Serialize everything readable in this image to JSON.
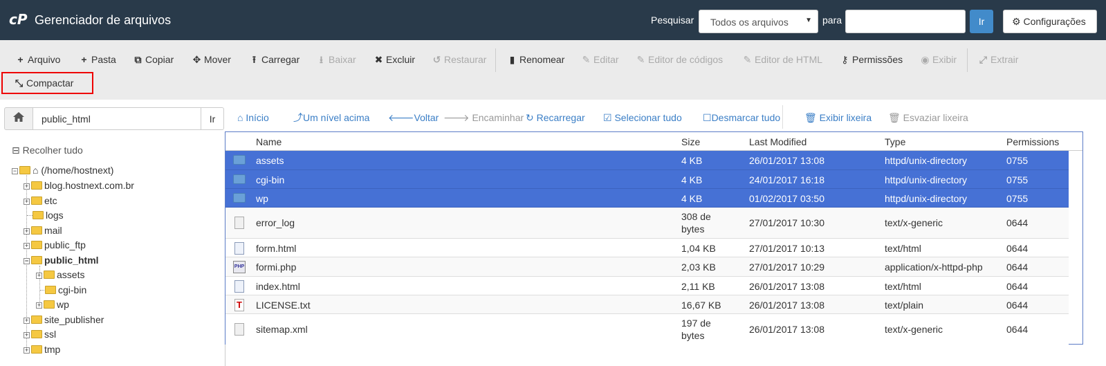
{
  "header": {
    "app_title": "Gerenciador de arquivos",
    "search_label": "Pesquisar",
    "search_scope": "Todos os arquivos",
    "para_label": "para",
    "search_placeholder": "",
    "go_label": "Ir",
    "settings_label": "Configurações",
    "colors": {
      "background": "#293a4a",
      "go_button": "#428bca"
    }
  },
  "toolbar": {
    "items": [
      {
        "label": "Arquivo",
        "icon": "plus-icon",
        "enabled": true
      },
      {
        "label": "Pasta",
        "icon": "plus-icon",
        "enabled": true
      },
      {
        "label": "Copiar",
        "icon": "copy-icon",
        "enabled": true
      },
      {
        "label": "Mover",
        "icon": "move-icon",
        "enabled": true
      },
      {
        "label": "Carregar",
        "icon": "upload-icon",
        "enabled": true
      },
      {
        "label": "Baixar",
        "icon": "download-icon",
        "enabled": false
      },
      {
        "label": "Excluir",
        "icon": "times-icon",
        "enabled": true
      },
      {
        "label": "Restaurar",
        "icon": "undo-icon",
        "enabled": false
      },
      {
        "label": "Renomear",
        "icon": "file-icon",
        "enabled": true
      },
      {
        "label": "Editar",
        "icon": "pencil-icon",
        "enabled": false
      },
      {
        "label": "Editor de códigos",
        "icon": "edit-icon",
        "enabled": false
      },
      {
        "label": "Editor de HTML",
        "icon": "edit-icon",
        "enabled": false
      },
      {
        "label": "Permissões",
        "icon": "key-icon",
        "enabled": true
      },
      {
        "label": "Exibir",
        "icon": "eye-icon",
        "enabled": false
      },
      {
        "label": "Extrair",
        "icon": "expand-icon",
        "enabled": false
      },
      {
        "label": "Compactar",
        "icon": "compress-icon",
        "enabled": true
      }
    ]
  },
  "path_bar": {
    "path": "public_html",
    "go_label": "Ir"
  },
  "tree": {
    "collapse_label": "Recolher tudo",
    "root_label": "(/home/hostnext)",
    "nodes": [
      {
        "label": "blog.hostnext.com.br"
      },
      {
        "label": "etc"
      },
      {
        "label": "logs"
      },
      {
        "label": "mail"
      },
      {
        "label": "public_ftp"
      },
      {
        "label": "public_html"
      },
      {
        "label": "assets"
      },
      {
        "label": "cgi-bin"
      },
      {
        "label": "wp"
      },
      {
        "label": "site_publisher"
      },
      {
        "label": "ssl"
      },
      {
        "label": "tmp"
      }
    ]
  },
  "actions": {
    "items": [
      {
        "label": "Início",
        "icon": "home-icon"
      },
      {
        "label": "Um nível acima",
        "icon": "level-up-icon"
      },
      {
        "label": "Voltar",
        "icon": "arrow-left-icon"
      },
      {
        "label": "Encaminhar",
        "icon": "arrow-right-icon"
      },
      {
        "label": "Recarregar",
        "icon": "refresh-icon"
      },
      {
        "label": "Selecionar tudo",
        "icon": "check-square-icon"
      },
      {
        "label": "Desmarcar tudo",
        "icon": "square-icon"
      },
      {
        "label": "Exibir lixeira",
        "icon": "trash-icon"
      },
      {
        "label": "Esvaziar lixeira",
        "icon": "trash-icon"
      }
    ]
  },
  "table": {
    "columns": [
      "Name",
      "Size",
      "Last Modified",
      "Type",
      "Permissions"
    ],
    "rows": [
      {
        "name": "assets",
        "size": "4 KB",
        "modified": "26/01/2017 13:08",
        "type": "httpd/unix-directory",
        "perms": "0755",
        "icon": "folder-icon",
        "selected": true
      },
      {
        "name": "cgi-bin",
        "size": "4 KB",
        "modified": "24/01/2017 16:18",
        "type": "httpd/unix-directory",
        "perms": "0755",
        "icon": "folder-icon",
        "selected": true
      },
      {
        "name": "wp",
        "size": "4 KB",
        "modified": "01/02/2017 03:50",
        "type": "httpd/unix-directory",
        "perms": "0755",
        "icon": "folder-icon",
        "selected": true
      },
      {
        "name": "error_log",
        "size": "308 de bytes",
        "modified": "27/01/2017 10:30",
        "type": "text/x-generic",
        "perms": "0644",
        "icon": "document-icon",
        "selected": false
      },
      {
        "name": "form.html",
        "size": "1,04 KB",
        "modified": "27/01/2017 10:13",
        "type": "text/html",
        "perms": "0644",
        "icon": "html-file-icon",
        "selected": false
      },
      {
        "name": "formi.php",
        "size": "2,03 KB",
        "modified": "27/01/2017 10:29",
        "type": "application/x-httpd-php",
        "perms": "0644",
        "icon": "php-file-icon",
        "selected": false
      },
      {
        "name": "index.html",
        "size": "2,11 KB",
        "modified": "26/01/2017 13:08",
        "type": "text/html",
        "perms": "0644",
        "icon": "html-file-icon",
        "selected": false
      },
      {
        "name": "LICENSE.txt",
        "size": "16,67 KB",
        "modified": "26/01/2017 13:08",
        "type": "text/plain",
        "perms": "0644",
        "icon": "text-file-icon",
        "selected": false
      },
      {
        "name": "sitemap.xml",
        "size": "197 de bytes",
        "modified": "26/01/2017 13:08",
        "type": "text/x-generic",
        "perms": "0644",
        "icon": "document-icon",
        "selected": false
      }
    ],
    "colors": {
      "selected_row": "#4671d5"
    }
  }
}
